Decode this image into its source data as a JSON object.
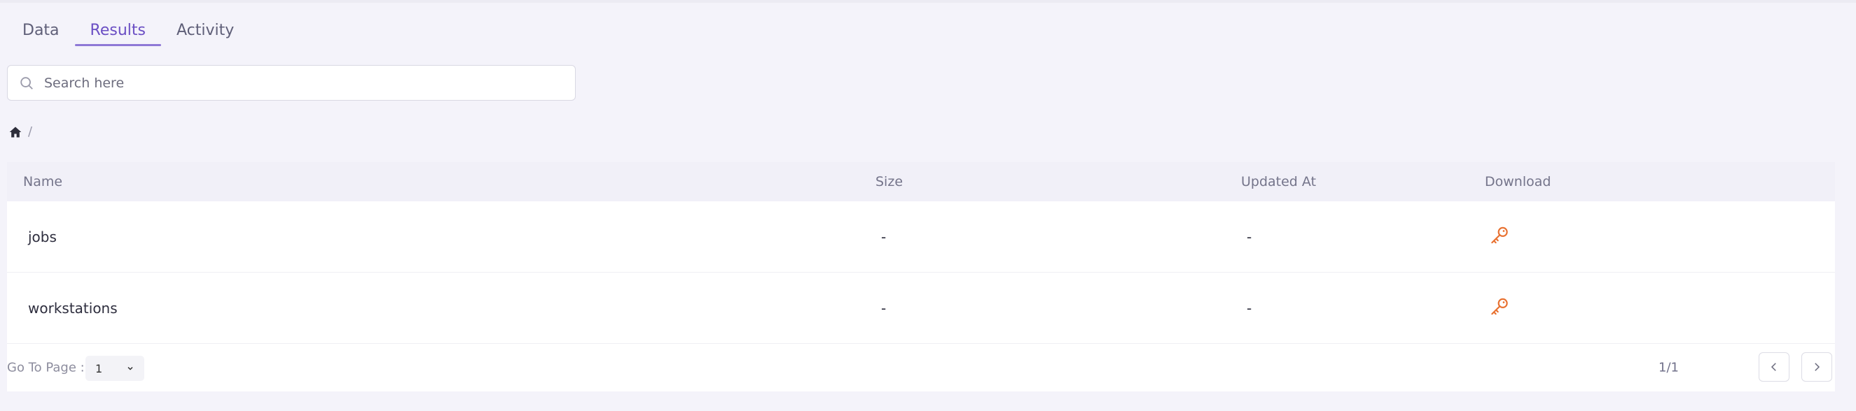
{
  "tabs": [
    {
      "label": "Data",
      "active": false
    },
    {
      "label": "Results",
      "active": true
    },
    {
      "label": "Activity",
      "active": false
    }
  ],
  "search": {
    "placeholder": "Search here",
    "value": ""
  },
  "breadcrumb": {
    "home_icon": "home-icon",
    "separator": "/"
  },
  "table": {
    "columns": {
      "name": "Name",
      "size": "Size",
      "updated_at": "Updated At",
      "download": "Download"
    },
    "rows": [
      {
        "name": "jobs",
        "size": "-",
        "updated_at": "-",
        "download_icon": "key-icon"
      },
      {
        "name": "workstations",
        "size": "-",
        "updated_at": "-",
        "download_icon": "key-icon"
      }
    ]
  },
  "pagination": {
    "goto_label": "Go To Page :",
    "selected_page": "1",
    "page_count": "1/1"
  },
  "colors": {
    "accent": "#6b4fc4",
    "download_icon": "#e8702f",
    "background": "#f4f3fa"
  }
}
